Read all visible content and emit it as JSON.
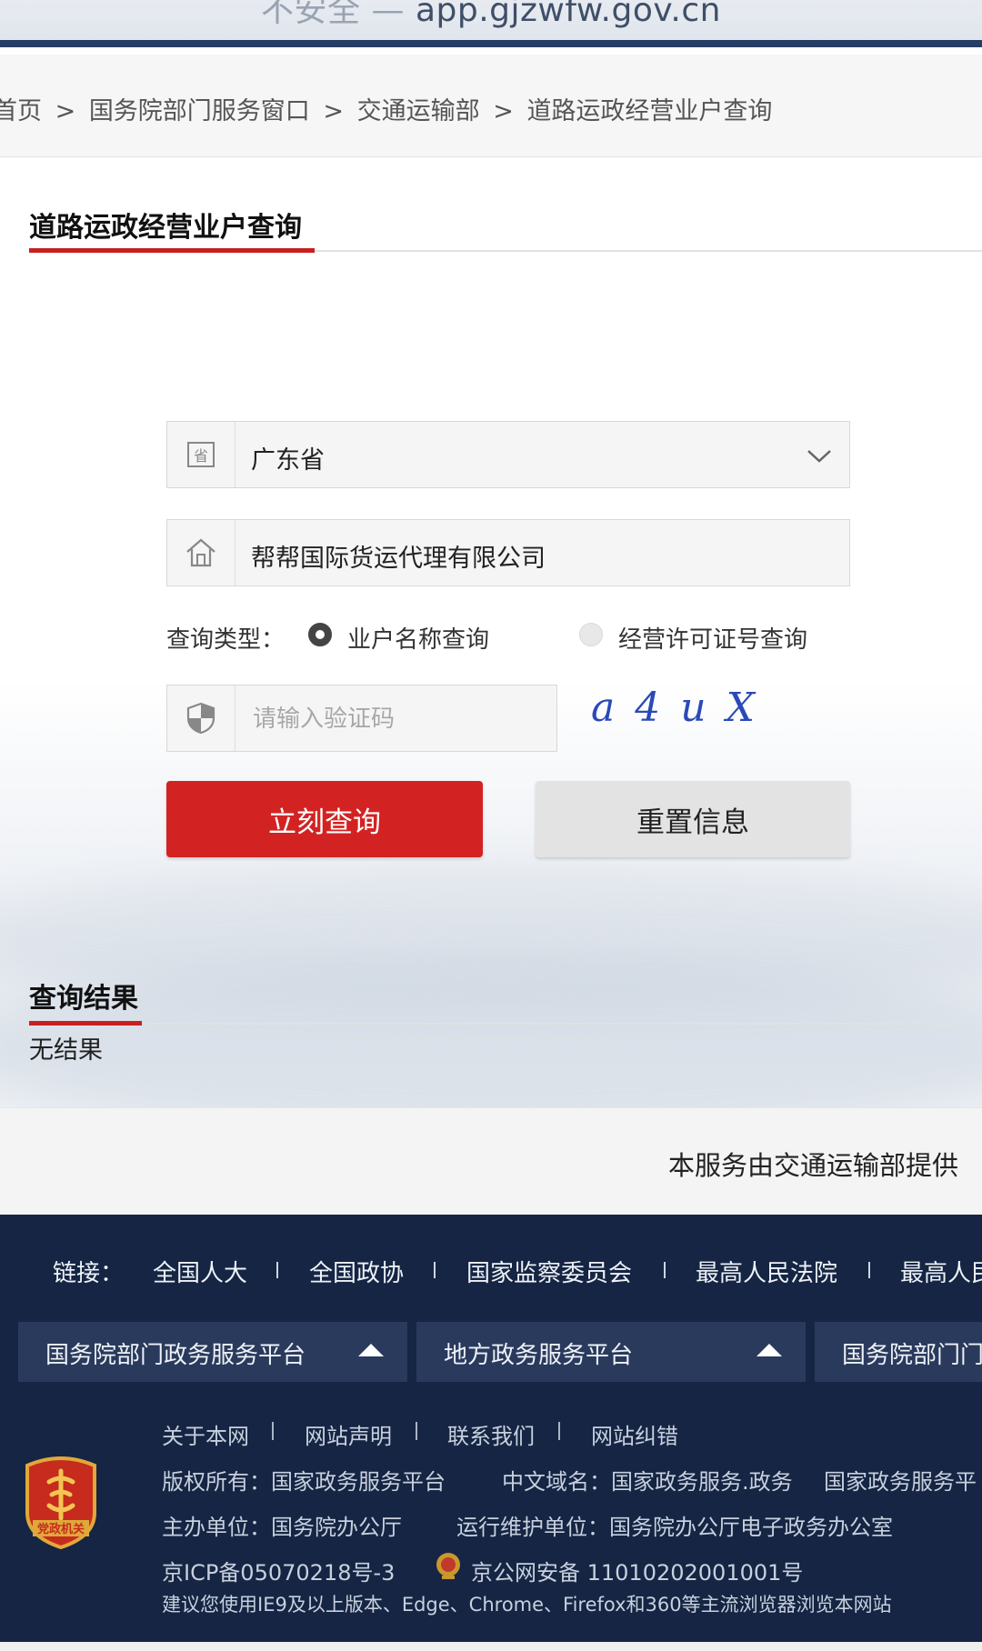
{
  "browser": {
    "security_text": "不安全",
    "separator": "—",
    "domain": "app.gjzwfw.gov.cn"
  },
  "breadcrumb": {
    "items": [
      "首页",
      "国务院部门服务窗口",
      "交通运输部",
      "道路运政经营业户查询"
    ],
    "sep": ">"
  },
  "form": {
    "title": "道路运政经营业户查询",
    "province_icon_text": "省",
    "province_value": "广东省",
    "company_value": "帮帮国际货运代理有限公司",
    "query_type_label": "查询类型：",
    "radio_name": "业户名称查询",
    "radio_license": "经营许可证号查询",
    "captcha_placeholder": "请输入验证码",
    "captcha_text": "a4uX",
    "submit_label": "立刻查询",
    "reset_label": "重置信息"
  },
  "result": {
    "title": "查询结果",
    "text": "无结果"
  },
  "provider": "本服务由交通运输部提供",
  "footer": {
    "links_label": "链接：",
    "links": [
      "全国人大",
      "全国政协",
      "国家监察委员会",
      "最高人民法院",
      "最高人民"
    ],
    "platforms": [
      "国务院部门政务服务平台",
      "地方政务服务平台",
      "国务院部门门"
    ],
    "nav": [
      "关于本网",
      "网站声明",
      "联系我们",
      "网站纠错"
    ],
    "copyright": "版权所有：国家政务服务平台",
    "cn_domain": "中文域名：国家政务服务.政务",
    "cn_domain2": "国家政务服务平",
    "host": "主办单位：国务院办公厅",
    "maintainer": "运行维护单位：国务院办公厅电子政务办公室",
    "icp": "京ICP备05070218号-3",
    "police": "京公网安备 11010202001001号",
    "browser_tip": "建议您使用IE9及以上版本、Edge、Chrome、Firefox和360等主流浏览器浏览本网站",
    "emblem_text": "党政机关"
  },
  "colors": {
    "accent_red": "#d32222",
    "footer_bg": "#152543",
    "captcha_blue": "#2a49b8"
  }
}
